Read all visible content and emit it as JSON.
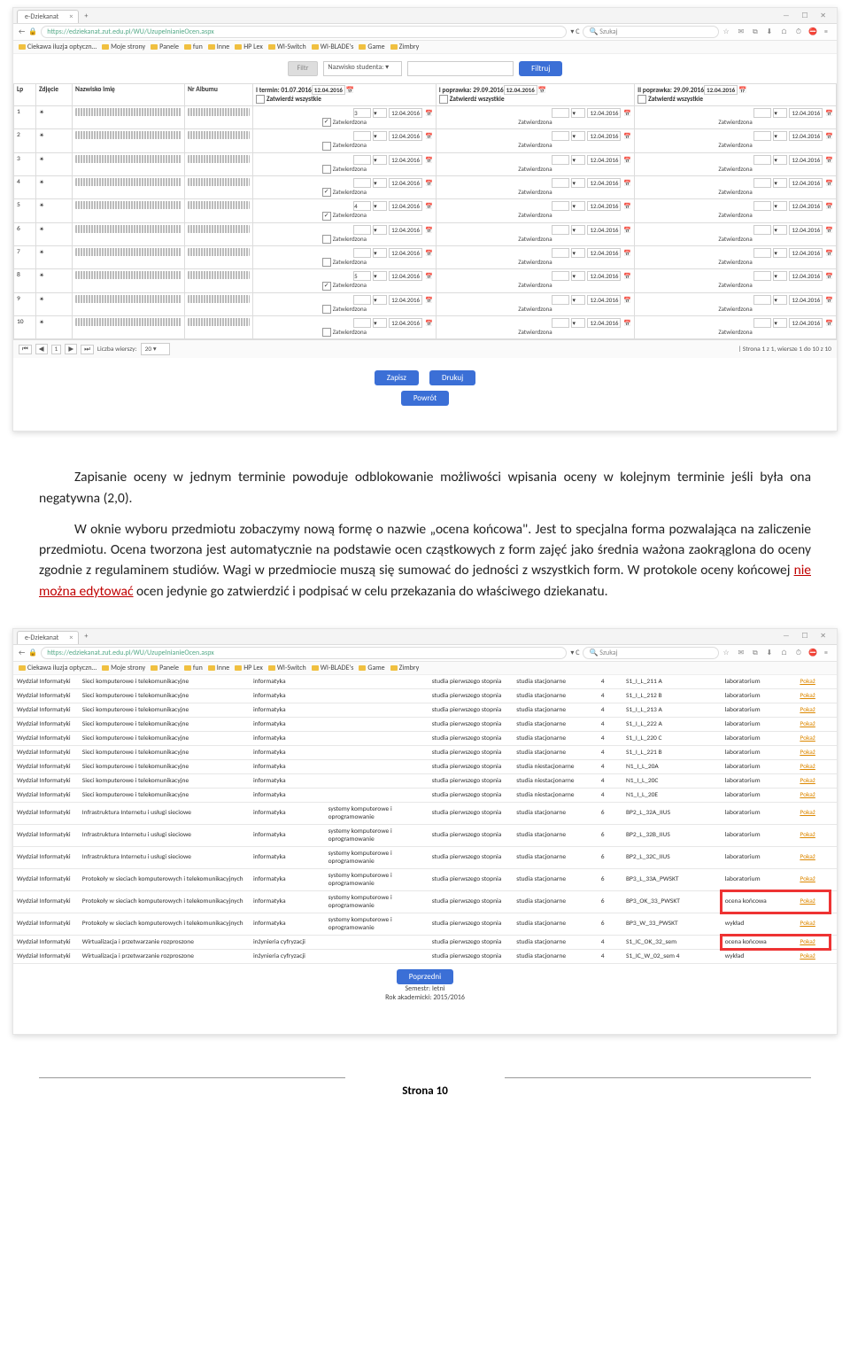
{
  "browser": {
    "tab_title": "e-Dziekanat",
    "url": "https://edziekanat.zut.edu.pl/WU/UzupelnianieOcen.aspx",
    "url_scheme": "🔒",
    "search_placeholder": "Szukaj",
    "window_buttons": "—  ☐  ✕",
    "toolbar_icons": "☆  ✉  ⧉  ⬇  ⌂  ⏱",
    "toolbar_menu": "≡",
    "bookmarks": [
      "Ciekawa iluzja optyczn…",
      "Moje strony",
      "Panele",
      "fun",
      "Inne",
      "HP Lex",
      "WI-Switch",
      "WI-BLADE's",
      "Game",
      "Zimbry"
    ]
  },
  "grades": {
    "filter_btn": "Filtr",
    "filter_select": "Nazwisko studenta:",
    "filter_apply": "Filtruj",
    "cols": {
      "lp": "Lp",
      "photo": "Zdjęcie",
      "name": "Nazwisko Imię",
      "album": "Nr Albumu"
    },
    "term1": {
      "label": "I termin: 01.07.2016",
      "date": "12.04.2016"
    },
    "term2": {
      "label": "I poprawka: 29.09.2016",
      "date": "12.04.2016"
    },
    "term3": {
      "label": "II poprawka: 29.09.2016",
      "date": "12.04.2016"
    },
    "approve_all": "Zatwierdź wszystkie",
    "rows": [
      {
        "lp": "1",
        "g1": "3",
        "cb1": true,
        "d": "12.04.2016",
        "s": "Zatwierdzona"
      },
      {
        "lp": "2",
        "g1": "",
        "cb1": false,
        "d": "12.04.2016",
        "s": "Zatwierdzona"
      },
      {
        "lp": "3",
        "g1": "",
        "cb1": false,
        "d": "12.04.2016",
        "s": "Zatwierdzona"
      },
      {
        "lp": "4",
        "g1": "",
        "cb1": true,
        "d": "12.04.2016",
        "s": "Zatwierdzona"
      },
      {
        "lp": "5",
        "g1": "4",
        "cb1": true,
        "d": "12.04.2016",
        "s": "Zatwierdzona"
      },
      {
        "lp": "6",
        "g1": "",
        "cb1": false,
        "d": "12.04.2016",
        "s": "Zatwierdzona"
      },
      {
        "lp": "7",
        "g1": "",
        "cb1": false,
        "d": "12.04.2016",
        "s": "Zatwierdzona"
      },
      {
        "lp": "8",
        "g1": "5",
        "cb1": true,
        "d": "12.04.2016",
        "s": "Zatwierdzona"
      },
      {
        "lp": "9",
        "g1": "",
        "cb1": false,
        "d": "12.04.2016",
        "s": "Zatwierdzona"
      },
      {
        "lp": "10",
        "g1": "",
        "cb1": false,
        "d": "12.04.2016",
        "s": "Zatwierdzona"
      }
    ],
    "pager": {
      "rows_label": "Liczba wierszy:",
      "rows_val": "20",
      "info": "| Strona 1 z 1, wiersze 1 do 10 z 10"
    },
    "btn_save": "Zapisz",
    "btn_print": "Drukuj",
    "btn_back": "Powrót"
  },
  "text": {
    "p1": "Zapisanie oceny w jednym terminie powoduje odblokowanie możliwości wpisania oceny w kolejnym terminie jeśli była ona negatywna (2,0).",
    "p2a": "W oknie wyboru przedmiotu zobaczymy nową formę o nazwie „ocena końcowa\". Jest to specjalna forma pozwalająca na zaliczenie przedmiotu. Ocena tworzona jest automatycznie na podstawie ocen cząstkowych z form zajęć jako średnia ważona zaokrąglona do oceny zgodnie z regulaminem studiów. Wagi w przedmiocie muszą się sumować do jedności z wszystkich form. W protokole oceny końcowej ",
    "p2b": "nie można edytować",
    "p2c": " ocen jedynie go zatwierdzić i podpisać w celu przekazania do właściwego dziekanatu."
  },
  "subjects": {
    "dept": "Wydział Informatyki",
    "sub_net": "Sieci komputerowe i telekomunikacyjne",
    "sub_inf": "Infrastruktura Internetu i usługi sieciowe",
    "sub_proto": "Protokoły w sieciach komputerowych i telekomunikacyjnych",
    "sub_wirt": "Wirtualizacja i przetwarzanie rozproszone",
    "kier": "informatyka",
    "krypt": "inżynieria cyfryzacji",
    "spec_sys": "systemy komputerowe i oprogramowanie",
    "deg1": "studia pierwszego stopnia",
    "mode_s": "studia stacjonarne",
    "mode_n": "studia niestacjonarne",
    "lab": "laboratorium",
    "final": "ocena końcowa",
    "lecture": "wykład",
    "show": "Pokaż",
    "rows": [
      {
        "s": "sub_net",
        "k": "kier",
        "sp": "",
        "d": "deg1",
        "m": "mode_s",
        "sem": "4",
        "g": "S1_I_L_211 A",
        "f": "lab"
      },
      {
        "s": "sub_net",
        "k": "kier",
        "sp": "",
        "d": "deg1",
        "m": "mode_s",
        "sem": "4",
        "g": "S1_I_L_212 B",
        "f": "lab"
      },
      {
        "s": "sub_net",
        "k": "kier",
        "sp": "",
        "d": "deg1",
        "m": "mode_s",
        "sem": "4",
        "g": "S1_I_L_213 A",
        "f": "lab"
      },
      {
        "s": "sub_net",
        "k": "kier",
        "sp": "",
        "d": "deg1",
        "m": "mode_s",
        "sem": "4",
        "g": "S1_I_L_222 A",
        "f": "lab"
      },
      {
        "s": "sub_net",
        "k": "kier",
        "sp": "",
        "d": "deg1",
        "m": "mode_s",
        "sem": "4",
        "g": "S1_I_L_220 C",
        "f": "lab"
      },
      {
        "s": "sub_net",
        "k": "kier",
        "sp": "",
        "d": "deg1",
        "m": "mode_s",
        "sem": "4",
        "g": "S1_I_L_221 B",
        "f": "lab"
      },
      {
        "s": "sub_net",
        "k": "kier",
        "sp": "",
        "d": "deg1",
        "m": "mode_n",
        "sem": "4",
        "g": "N1_I_L_20A",
        "f": "lab"
      },
      {
        "s": "sub_net",
        "k": "kier",
        "sp": "",
        "d": "deg1",
        "m": "mode_n",
        "sem": "4",
        "g": "N1_I_L_20C",
        "f": "lab"
      },
      {
        "s": "sub_net",
        "k": "kier",
        "sp": "",
        "d": "deg1",
        "m": "mode_n",
        "sem": "4",
        "g": "N1_I_L_20E",
        "f": "lab"
      },
      {
        "s": "sub_inf",
        "k": "kier",
        "sp": "spec_sys",
        "d": "deg1",
        "m": "mode_s",
        "sem": "6",
        "g": "BP2_L_32A_IIUS",
        "f": "lab"
      },
      {
        "s": "sub_inf",
        "k": "kier",
        "sp": "spec_sys",
        "d": "deg1",
        "m": "mode_s",
        "sem": "6",
        "g": "BP2_L_32B_IIUS",
        "f": "lab"
      },
      {
        "s": "sub_inf",
        "k": "kier",
        "sp": "spec_sys",
        "d": "deg1",
        "m": "mode_s",
        "sem": "6",
        "g": "BP2_L_32C_IIUS",
        "f": "lab"
      },
      {
        "s": "sub_proto",
        "k": "kier",
        "sp": "spec_sys",
        "d": "deg1",
        "m": "mode_s",
        "sem": "6",
        "g": "BP3_L_33A_PWSKT",
        "f": "lab"
      },
      {
        "s": "sub_proto",
        "k": "kier",
        "sp": "spec_sys",
        "d": "deg1",
        "m": "mode_s",
        "sem": "6",
        "g": "BP3_OK_33_PWSKT",
        "f": "final",
        "hl": true
      },
      {
        "s": "sub_proto",
        "k": "kier",
        "sp": "spec_sys",
        "d": "deg1",
        "m": "mode_s",
        "sem": "6",
        "g": "BP3_W_33_PWSKT",
        "f": "lecture"
      },
      {
        "s": "sub_wirt",
        "k": "krypt",
        "sp": "",
        "d": "deg1",
        "m": "mode_s",
        "sem": "4",
        "g": "S1_IC_OK_32_sem",
        "f": "final",
        "hl": true
      },
      {
        "s": "sub_wirt",
        "k": "krypt",
        "sp": "",
        "d": "deg1",
        "m": "mode_s",
        "sem": "4",
        "g": "S1_IC_W_02_sem 4",
        "f": "lecture"
      }
    ],
    "prev": "Poprzedni",
    "sem": "Semestr: letni",
    "year": "Rok akademicki: 2015/2016"
  },
  "footer": "Strona 10"
}
